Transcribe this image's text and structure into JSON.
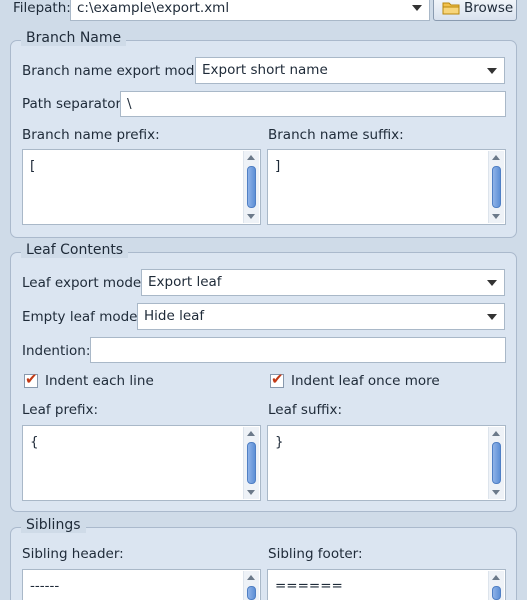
{
  "filepath": {
    "label": "Filepath:",
    "value": "c:\\example\\export.xml",
    "browse_label": "Browse"
  },
  "branch": {
    "title": "Branch Name",
    "mode_label": "Branch name export mode:",
    "mode_value": "Export short name",
    "separator_label": "Path separator:",
    "separator_value": "\\",
    "prefix_label": "Branch name prefix:",
    "prefix_value": "[",
    "suffix_label": "Branch name suffix:",
    "suffix_value": "]"
  },
  "leaf": {
    "title": "Leaf Contents",
    "mode_label": "Leaf export mode:",
    "mode_value": "Export leaf",
    "empty_label": "Empty leaf mode:",
    "empty_value": "Hide leaf",
    "indention_label": "Indention:",
    "indention_value": "",
    "indent_each_label": "Indent each line",
    "indent_each_checked": true,
    "indent_once_label": "Indent leaf once more",
    "indent_once_checked": true,
    "prefix_label": "Leaf prefix:",
    "prefix_value": "{",
    "suffix_label": "Leaf suffix:",
    "suffix_value": "}"
  },
  "siblings": {
    "title": "Siblings",
    "header_label": "Sibling header:",
    "header_value": "------",
    "footer_label": "Sibling footer:",
    "footer_value": "======"
  },
  "icons": {
    "folder": "folder-icon",
    "check": "check-icon",
    "dropdown": "chevron-down-icon"
  },
  "colors": {
    "background": "#cfdbe8",
    "group": "#dbe5f1",
    "scroll_thumb": "#5d8fd6",
    "check": "#c23a16"
  }
}
